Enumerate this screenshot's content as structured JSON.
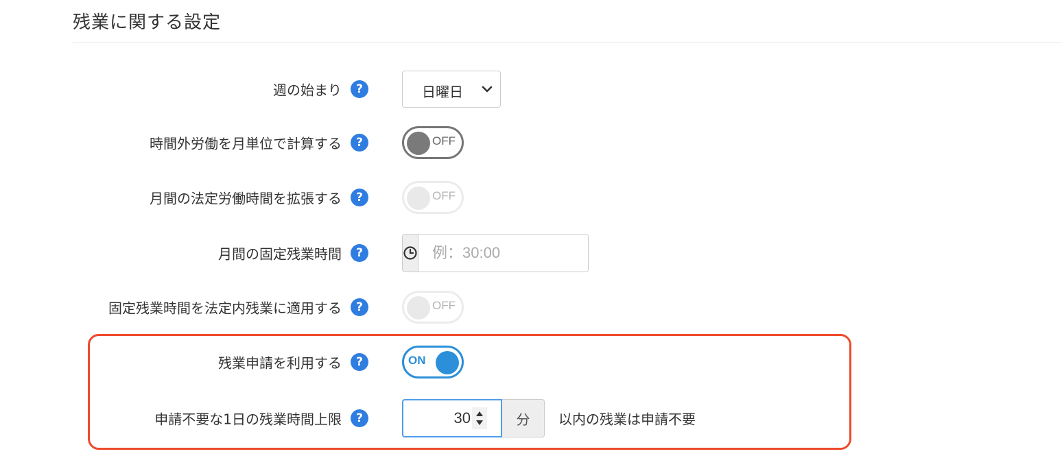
{
  "section": {
    "title": "残業に関する設定"
  },
  "rows": {
    "week_start": {
      "label": "週の始まり",
      "help": "?",
      "select_value": "日曜日"
    },
    "monthly_calc": {
      "label": "時間外労働を月単位で計算する",
      "help": "?",
      "toggle_label": "OFF",
      "state": "off"
    },
    "extend_legal": {
      "label": "月間の法定労働時間を拡張する",
      "help": "?",
      "toggle_label": "OFF",
      "state": "off-disabled"
    },
    "fixed_overtime": {
      "label": "月間の固定残業時間",
      "help": "?",
      "placeholder": "例：30:00",
      "value": ""
    },
    "apply_fixed": {
      "label": "固定残業時間を法定内残業に適用する",
      "help": "?",
      "toggle_label": "OFF",
      "state": "off-disabled"
    },
    "overtime_request": {
      "label": "残業申請を利用する",
      "help": "?",
      "toggle_label": "ON",
      "state": "on"
    },
    "request_limit": {
      "label": "申請不要な1日の残業時間上限",
      "help": "?",
      "value": "30",
      "unit": "分",
      "suffix": "以内の残業は申請不要"
    }
  },
  "icons": {
    "help": "question-circle-icon",
    "clock": "clock-icon",
    "chevron": "chevron-down-icon",
    "spinner": "spinner-arrows-icon"
  },
  "colors": {
    "accent": "#2b8fd9",
    "help_icon": "#2f7de1",
    "highlight": "#ee4a2c",
    "toggle_off": "#777777"
  }
}
